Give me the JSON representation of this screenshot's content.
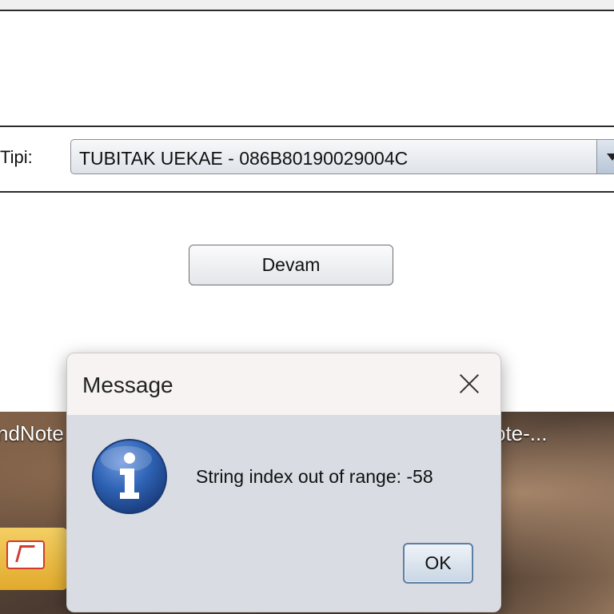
{
  "form": {
    "tipi_label": "Tipi:",
    "combo_value": "TUBITAK UEKAE - 086B80190029004C",
    "continue_label": "Devam"
  },
  "desktop": {
    "left_label": "ndNote",
    "right_label": "ote-..."
  },
  "dialog": {
    "title": "Message",
    "message": "String index out of range: -58",
    "ok_label": "OK",
    "icon": "info-icon"
  },
  "colors": {
    "dialog_body": "#d9dce3",
    "dialog_titlebar": "#f6f3f2",
    "info_blue": "#2a5aa8"
  }
}
